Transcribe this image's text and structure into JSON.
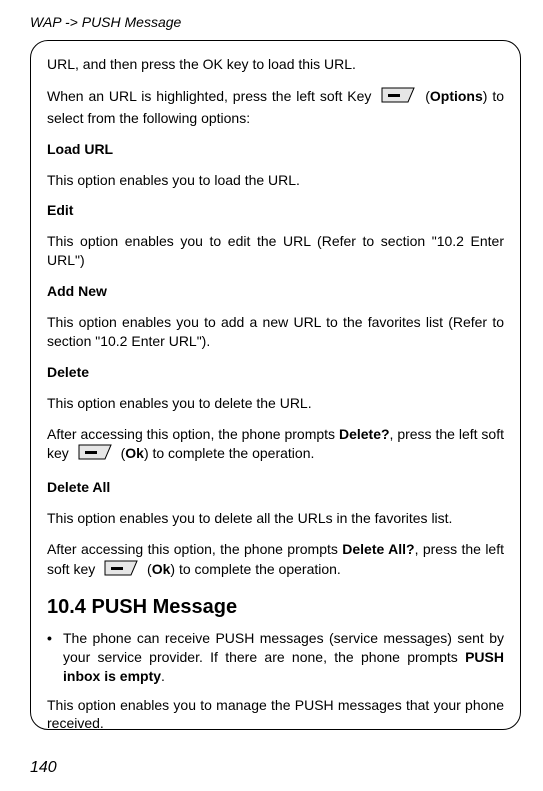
{
  "running_head": "WAP -> PUSH Message",
  "intro_line": "URL, and then press the OK key to load this URL.",
  "highlight_pre": "When an URL is highlighted, press the left soft Key ",
  "highlight_open_paren": " (",
  "highlight_options": "Options",
  "highlight_post": ") to select from the following options:",
  "load_url_head": "Load URL",
  "load_url_body": "This option enables you to load the URL.",
  "edit_head": "Edit",
  "edit_body": "This option enables you to edit the URL (Refer to section \"10.2 Enter URL\")",
  "addnew_head": "Add New",
  "addnew_body": "This option enables you to add a new URL to the favorites list (Refer to section \"10.2 Enter URL\").",
  "delete_head": "Delete",
  "delete_body": "This option enables you to delete the URL.",
  "delete_prompt_pre": "After accessing this option, the phone prompts ",
  "delete_prompt_bold": "Delete?",
  "delete_prompt_mid": ", press the left soft key ",
  "delete_prompt_open_paren": " (",
  "delete_prompt_ok": "Ok",
  "delete_prompt_post": ") to complete the operation.",
  "deleteall_head": "Delete All",
  "deleteall_body": "This option enables you to delete all the URLs in the favorites list.",
  "deleteall_prompt_pre": "After accessing this option, the phone prompts ",
  "deleteall_prompt_bold": "Delete All?",
  "deleteall_prompt_mid": ", press the left soft key ",
  "deleteall_prompt_open_paren": " (",
  "deleteall_prompt_ok": "Ok",
  "deleteall_prompt_post": ") to complete the operation.",
  "push_head": "10.4 PUSH Message",
  "push_bullet_pre": "The phone can receive PUSH messages (service messages) sent by your service provider. If there are none, the phone prompts ",
  "push_bullet_bold": "PUSH inbox is empty",
  "push_bullet_post": ".",
  "push_manage": "This option enables you to manage the PUSH messages that your phone received.",
  "page_number": "140"
}
